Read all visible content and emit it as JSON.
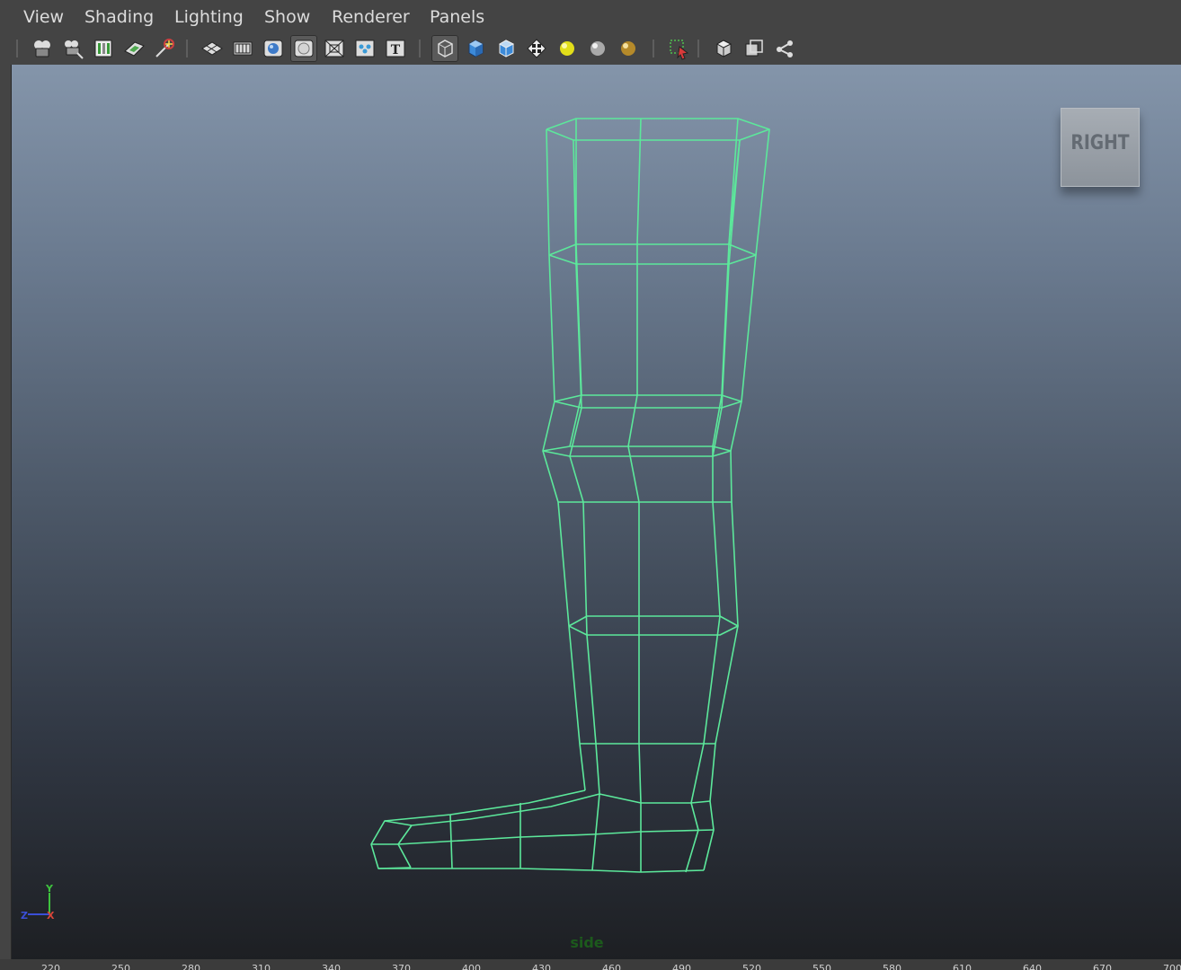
{
  "menu": {
    "items": [
      {
        "name": "menu-view",
        "label": "View"
      },
      {
        "name": "menu-shading",
        "label": "Shading"
      },
      {
        "name": "menu-lighting",
        "label": "Lighting"
      },
      {
        "name": "menu-show",
        "label": "Show"
      },
      {
        "name": "menu-renderer",
        "label": "Renderer"
      },
      {
        "name": "menu-panels",
        "label": "Panels"
      }
    ]
  },
  "toolbar": {
    "groups": [
      [
        "select-camera-icon",
        "camera-attributes-icon",
        "bookmarks-icon",
        "image-plane-icon",
        "2d-pan-zoom-icon"
      ],
      [
        "grid-icon",
        "film-gate-icon",
        "resolution-gate-icon",
        "gate-mask-icon",
        "field-chart-icon",
        "safe-action-icon",
        "safe-title-icon"
      ],
      [
        "wireframe-icon",
        "smooth-shade-icon",
        "wireframe-on-shaded-icon",
        "textured-icon",
        "use-all-lights-icon",
        "shadows-icon",
        "screen-space-ambient-occlusion-icon"
      ],
      [
        "isolate-select-icon"
      ],
      [
        "xray-icon",
        "xray-active-components-icon",
        "xray-joints-icon"
      ]
    ],
    "pressed": [
      "gate-mask-icon",
      "wireframe-icon"
    ]
  },
  "viewport": {
    "view_cube_label": "RIGHT",
    "camera_label": "side",
    "axis": {
      "y": "Y",
      "z": "Z",
      "x": "X"
    },
    "wire_color": "#5ce89b",
    "gradient_top": "#8495aa",
    "gradient_bottom": "#1d1f23"
  },
  "ruler": {
    "ticks": [
      "220",
      "250",
      "280",
      "310",
      "340",
      "370",
      "400",
      "430",
      "460",
      "490",
      "520",
      "550",
      "580",
      "610",
      "640",
      "670",
      "700"
    ]
  }
}
